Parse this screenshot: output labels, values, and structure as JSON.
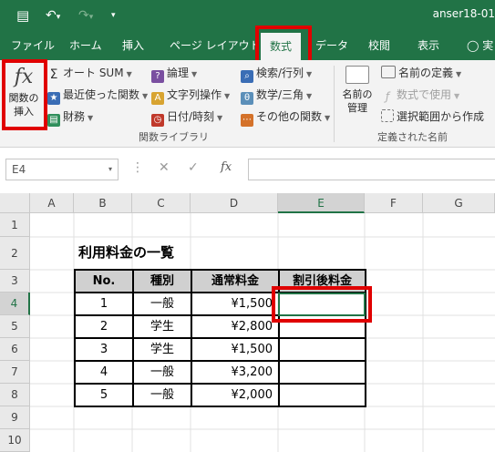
{
  "window": {
    "filename": "anser18-01",
    "quick_access": {
      "save": "💾",
      "undo": "↶",
      "undo_arrow": "▾",
      "redo": "↷",
      "redo_arrow": "▾",
      "customize": "▾"
    }
  },
  "tabs": [
    {
      "label": "ファイル"
    },
    {
      "label": "ホーム"
    },
    {
      "label": "挿入"
    },
    {
      "label": "ページ レイアウト"
    },
    {
      "label": "数式",
      "active": true
    },
    {
      "label": "データ"
    },
    {
      "label": "校閲"
    },
    {
      "label": "表示"
    },
    {
      "label": "実"
    }
  ],
  "ribbon": {
    "insert_function": {
      "icon": "fx",
      "label_line1": "関数の",
      "label_line2": "挿入"
    },
    "library_col1": [
      {
        "label": "オート SUM",
        "icon": "sigma-icon",
        "icon_glyph": "Σ"
      },
      {
        "label": "最近使った関数",
        "icon": "star-icon",
        "icon_glyph": "★"
      },
      {
        "label": "財務",
        "icon": "finance-icon",
        "icon_glyph": "▤"
      }
    ],
    "library_col2": [
      {
        "label": "論理",
        "icon": "logic-icon",
        "icon_glyph": "?"
      },
      {
        "label": "文字列操作",
        "icon": "text-icon",
        "icon_glyph": "A"
      },
      {
        "label": "日付/時刻",
        "icon": "datetime-icon",
        "icon_glyph": "◷"
      }
    ],
    "library_col3": [
      {
        "label": "検索/行列",
        "icon": "lookup-icon",
        "icon_glyph": "⌕"
      },
      {
        "label": "数学/三角",
        "icon": "math-icon",
        "icon_glyph": "θ"
      },
      {
        "label": "その他の関数",
        "icon": "more-functions-icon",
        "icon_glyph": "⋯"
      }
    ],
    "library_group_label": "関数ライブラリ",
    "name_manager": {
      "label_line1": "名前の",
      "label_line2": "管理"
    },
    "defined_names": [
      {
        "label": "名前の定義",
        "icon": "define-name-icon",
        "enabled": true
      },
      {
        "label": "数式で使用",
        "icon": "use-in-formula-icon",
        "enabled": false
      },
      {
        "label": "選択範囲から作成",
        "icon": "create-from-selection-icon",
        "enabled": true
      }
    ],
    "defined_names_group_label": "定義された名前"
  },
  "formula_bar": {
    "name_box": "E4",
    "dropdown": "▾",
    "more": "⋮",
    "cancel": "✕",
    "enter": "✓",
    "fx": "fx",
    "value": ""
  },
  "grid": {
    "columns": [
      "A",
      "B",
      "C",
      "D",
      "E",
      "F",
      "G"
    ],
    "rows": [
      "1",
      "2",
      "3",
      "4",
      "5",
      "6",
      "7",
      "8",
      "9",
      "10"
    ],
    "selected_cell": "E4",
    "sheet_title": "利用料金の一覧",
    "table": {
      "headers": [
        "No.",
        "種別",
        "通常料金",
        "割引後料金"
      ],
      "rows": [
        [
          "1",
          "一般",
          "¥1,500",
          ""
        ],
        [
          "2",
          "学生",
          "¥2,800",
          ""
        ],
        [
          "3",
          "学生",
          "¥1,500",
          ""
        ],
        [
          "4",
          "一般",
          "¥3,200",
          ""
        ],
        [
          "5",
          "一般",
          "¥2,000",
          ""
        ]
      ]
    }
  },
  "colors": {
    "excel_green": "#217346",
    "highlight_red": "#e00000"
  }
}
